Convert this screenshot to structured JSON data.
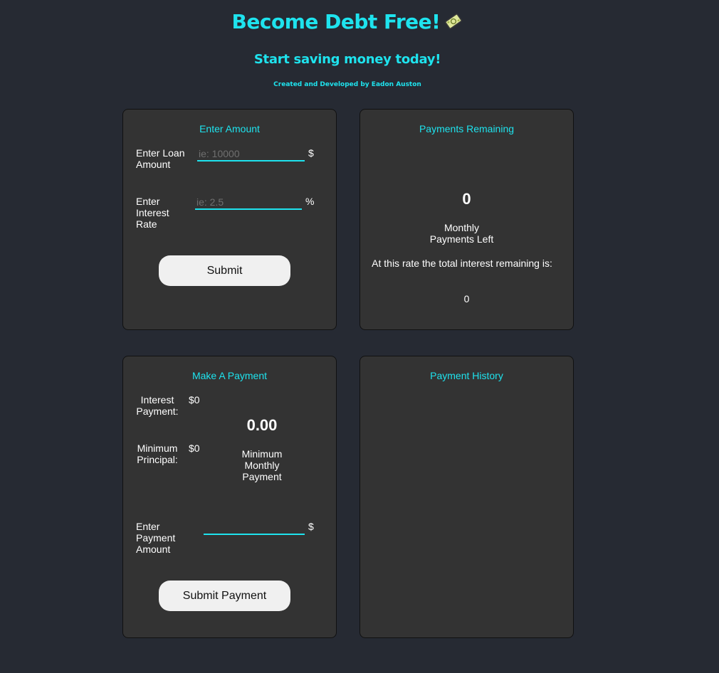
{
  "header": {
    "title": "Become Debt Free!",
    "subtitle": "Start saving money today!",
    "credit": "Created and Developed by Eadon Auston",
    "emoji_icon": "money-with-wings-icon"
  },
  "enter_amount": {
    "title": "Enter Amount",
    "loan_label": "Enter Loan Amount",
    "loan_placeholder": "ie: 10000",
    "loan_unit": "$",
    "rate_label": "Enter Interest Rate",
    "rate_placeholder": "ie: 2.5",
    "rate_unit": "%",
    "submit_label": "Submit"
  },
  "payments_remaining": {
    "title": "Payments Remaining",
    "count": "0",
    "count_caption": "Monthly Payments Left",
    "interest_caption": "At this rate the total interest remaining is:",
    "interest_value": "0"
  },
  "make_payment": {
    "title": "Make A Payment",
    "interest_label": "Interest Payment:",
    "interest_value": "$0",
    "principal_label": "Minimum Principal:",
    "principal_value": "$0",
    "minimum_value": "0.00",
    "minimum_caption": "Minimum Monthly Payment",
    "payment_label": "Enter Payment Amount",
    "payment_placeholder": "",
    "payment_unit": "$",
    "submit_label": "Submit Payment"
  },
  "payment_history": {
    "title": "Payment History"
  },
  "colors": {
    "background": "#262a33",
    "panel": "#333333",
    "accent": "#1ee3ee",
    "button": "#f0f0f0"
  }
}
